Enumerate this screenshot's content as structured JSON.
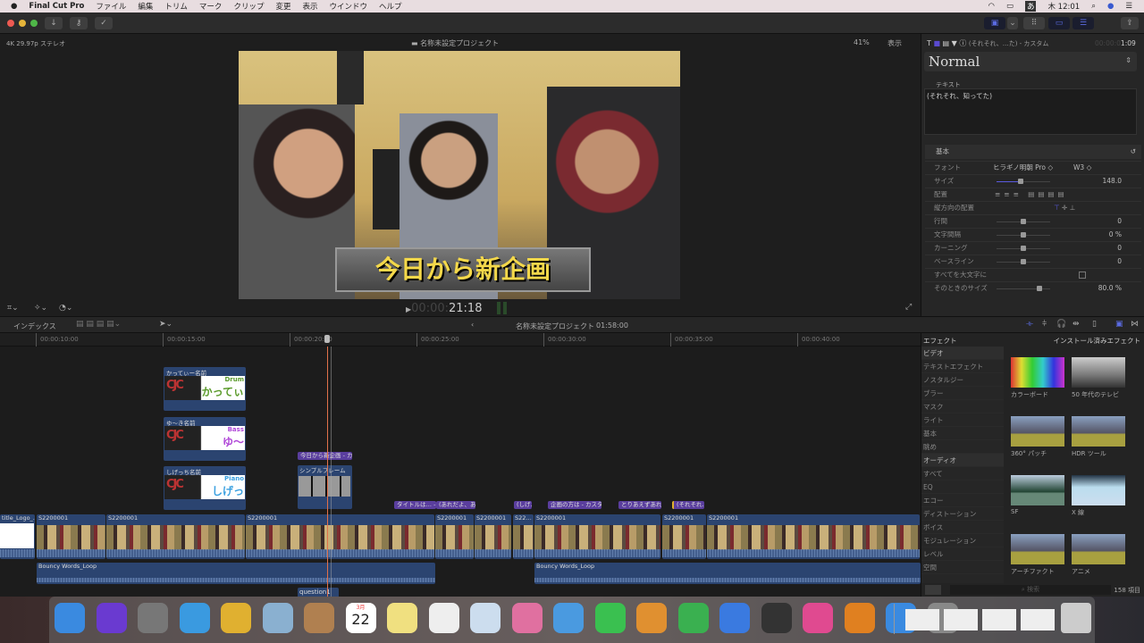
{
  "menubar": {
    "app": "Final Cut Pro",
    "items": [
      "ファイル",
      "編集",
      "トリム",
      "マーク",
      "クリップ",
      "変更",
      "表示",
      "ウインドウ",
      "ヘルプ"
    ],
    "clock": "木 12:01",
    "ime": "あ"
  },
  "viewer": {
    "format": "4K 29.97p ステレオ",
    "title": "名称未設定プロジェクト",
    "zoom": "41%",
    "view_menu": "表示",
    "caption": "今日から新企画",
    "timecode_dim": "00:00:",
    "timecode": "21:18"
  },
  "inspector": {
    "title": "(それそれ、…た) - カスタム",
    "timecode_dim": "00:00:0",
    "timecode": "1:09",
    "preset": "Normal",
    "text_label": "テキスト",
    "text_value": "(それそれ、知ってた)",
    "section": "基本",
    "rows": [
      {
        "label": "フォント",
        "value": "ヒラギノ明朝 Pro ◇",
        "extra": "W3 ◇"
      },
      {
        "label": "サイズ",
        "value": "148.0",
        "slider": 0.45
      },
      {
        "label": "配置",
        "value": ""
      },
      {
        "label": "縦方向の配置",
        "value": ""
      },
      {
        "label": "行間",
        "value": "0",
        "slider": 0.5
      },
      {
        "label": "文字間隔",
        "value": "0 %",
        "slider": 0.5
      },
      {
        "label": "カーニング",
        "value": "0",
        "slider": 0.5
      },
      {
        "label": "ベースライン",
        "value": "0",
        "slider": 0.5
      },
      {
        "label": "すべてを大文字に",
        "value": ""
      },
      {
        "label": "そのときのサイズ",
        "value": "80.0 %",
        "slider": 0.8
      }
    ]
  },
  "timeline": {
    "index": "インデックス",
    "project": "名称未設定プロジェクト",
    "duration": "01:58:00",
    "ruler": [
      "00:00:10:00",
      "00:00:15:00",
      "00:00:20:00",
      "00:00:25:00",
      "00:00:30:00",
      "00:00:35:00",
      "00:00:40:00"
    ],
    "title_clips": [
      {
        "name": "かってぃー名前",
        "role": "Drum",
        "text": "かってぃ"
      },
      {
        "name": "ゆ〜き名前",
        "role": "Bass",
        "text": "ゆ〜"
      },
      {
        "name": "しげっち名前",
        "role": "Piano",
        "text": "しげっ"
      }
    ],
    "frame_clip": "シンプルフレーム",
    "frame_tag": "今日から新企画 - カ…",
    "tags": [
      "タイトルは… - …",
      "(あれだよ、あ…",
      "(しげ…",
      "企画の方は - カスタム",
      "とりあえずあれ…",
      "(それそれ…"
    ],
    "video_clips": [
      "title_Logo_…",
      "S2200001",
      "S2200001",
      "S2200001",
      "S2200001",
      "S2200001",
      "S22…",
      "S2200001",
      "S2200001",
      "S2200001"
    ],
    "audio_clips": [
      "Bouncy Words_Loop",
      "Bouncy Words_Loop"
    ],
    "question_clip": "question1"
  },
  "effects": {
    "header": "エフェクト",
    "installed": "インストール済みエフェクト",
    "categories": [
      {
        "label": "ビデオ",
        "group": true
      },
      {
        "label": "テキストエフェクト"
      },
      {
        "label": "ノスタルジー"
      },
      {
        "label": "ブラー"
      },
      {
        "label": "マスク"
      },
      {
        "label": "ライト"
      },
      {
        "label": "基本"
      },
      {
        "label": "眺め"
      },
      {
        "label": "オーディオ",
        "group": true
      },
      {
        "label": "すべて"
      },
      {
        "label": "EQ"
      },
      {
        "label": "エコー"
      },
      {
        "label": "ディストーション"
      },
      {
        "label": "ボイス"
      },
      {
        "label": "モジュレーション"
      },
      {
        "label": "レベル"
      },
      {
        "label": "空間"
      }
    ],
    "items": [
      "カラーボード",
      "50 年代のテレビ",
      "360° パッチ",
      "HDR ツール",
      "SF",
      "X 線",
      "アーチファクト",
      "アニメ"
    ],
    "search_placeholder": "検索",
    "count": "158 項目"
  },
  "dock": {
    "calendar_month": "3月",
    "calendar_day": "22"
  },
  "colors": {
    "accent": "#5a3e9e",
    "clip": "#2b4470",
    "playhead": "#e0704a"
  }
}
